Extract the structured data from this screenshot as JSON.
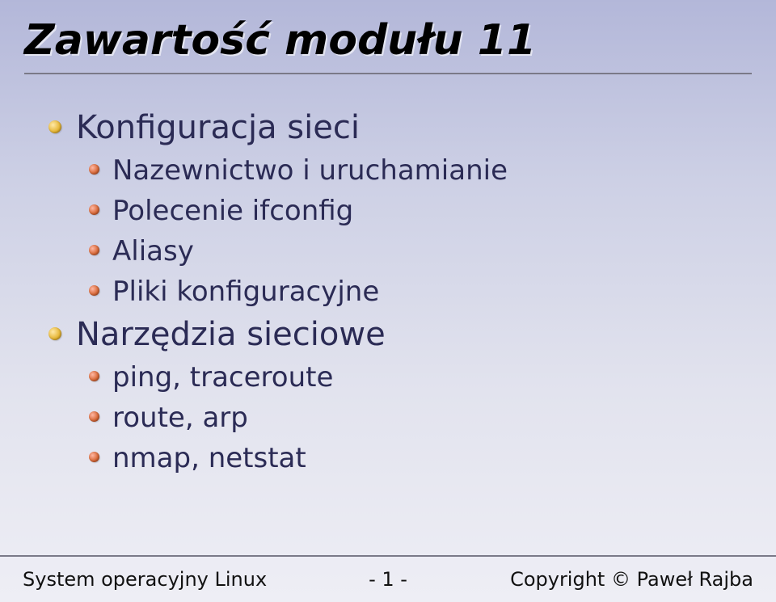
{
  "title": "Zawartość modułu 11",
  "content": {
    "lvl1": [
      {
        "label": "Konfiguracja sieci",
        "children": [
          "Nazewnictwo i uruchamianie",
          "Polecenie ifconfig",
          "Aliasy",
          "Pliki konfiguracyjne"
        ]
      },
      {
        "label": "Narzędzia sieciowe",
        "children": [
          "ping, traceroute",
          "route, arp",
          "nmap, netstat"
        ]
      }
    ]
  },
  "footer": {
    "left": "System operacyjny Linux",
    "center": "- 1 -",
    "right": "Copyright © Paweł Rajba"
  }
}
